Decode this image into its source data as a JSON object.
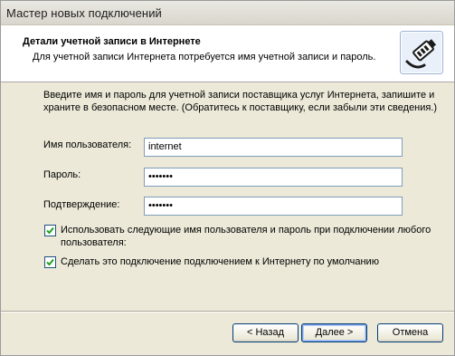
{
  "window": {
    "title": "Мастер новых подключений"
  },
  "header": {
    "title": "Детали учетной записи в Интернете",
    "subtitle": "Для учетной записи Интернета потребуется имя учетной записи и пароль.",
    "icon": "network-cable-plug-icon"
  },
  "content": {
    "intro": "Введите имя и пароль для учетной записи поставщика услуг Интернета, запишите и храните в безопасном месте. (Обратитесь к поставщику, если забыли эти сведения.)",
    "username": {
      "label": "Имя пользователя:",
      "value": "internet"
    },
    "password": {
      "label": "Пароль:",
      "value": "•••••••"
    },
    "confirm": {
      "label": "Подтверждение:",
      "value": "•••••••"
    },
    "checkbox_all_users": {
      "label": "Использовать следующие имя пользователя и пароль при подключении любого пользователя:",
      "checked": true
    },
    "checkbox_default": {
      "label": "Сделать это подключение подключением к Интернету по умолчанию",
      "checked": true
    }
  },
  "buttons": {
    "back": "< Назад",
    "next": "Далее >",
    "cancel": "Отмена"
  },
  "colors": {
    "face": "#ece9d8",
    "check_mark": "#21a121",
    "input_border": "#7f9db9"
  }
}
